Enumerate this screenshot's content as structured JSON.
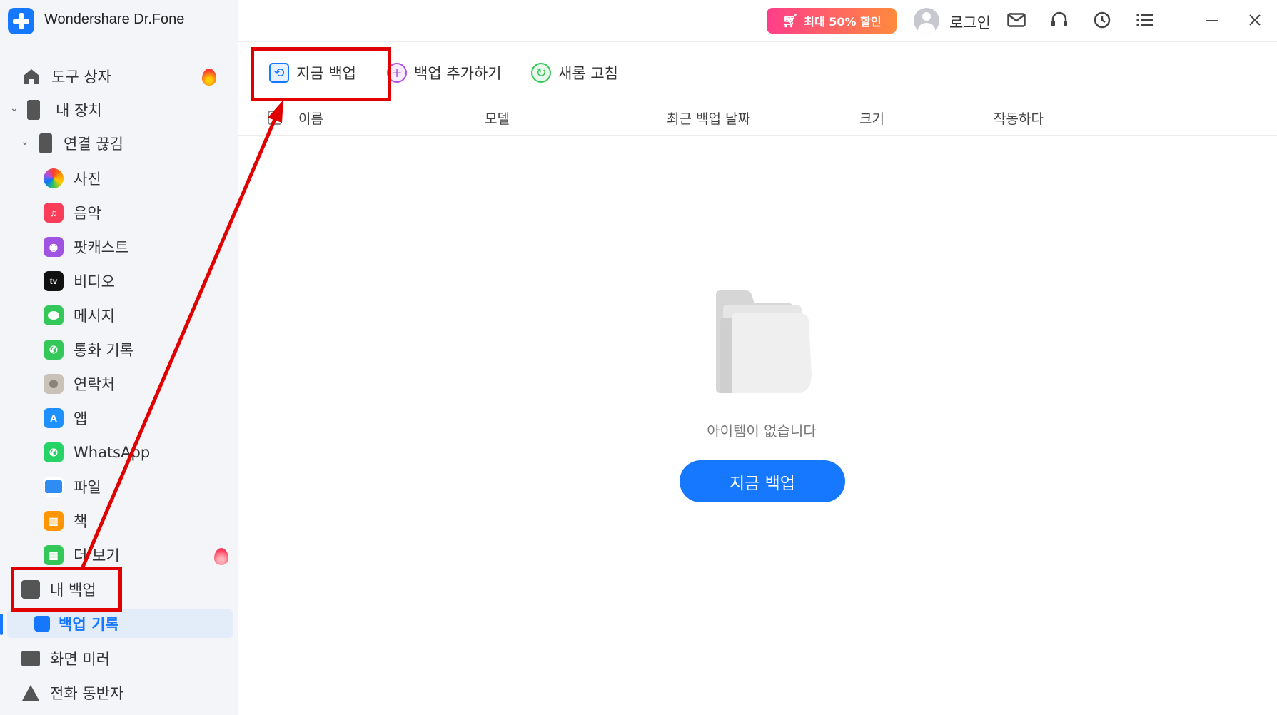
{
  "app": {
    "title": "Wondershare Dr.Fone",
    "logo_icon": "plus-logo-icon"
  },
  "topbar": {
    "promo_label": "최대 50% 할인",
    "login_label": "로그인",
    "icons": [
      "mail-icon",
      "headset-icon",
      "history-icon",
      "menu-icon",
      "minimize-icon",
      "close-icon"
    ]
  },
  "sidebar": {
    "toolbox": "도구 상자",
    "my_devices": "내 장치",
    "disconnected": "연결 끊김",
    "items": [
      {
        "label": "사진",
        "icon": "photos-icon",
        "color": "#ffffff"
      },
      {
        "label": "음악",
        "icon": "music-icon",
        "color": "#fa3e5a"
      },
      {
        "label": "팟캐스트",
        "icon": "podcast-icon",
        "color": "#a052e0"
      },
      {
        "label": "비디오",
        "icon": "appletv-icon",
        "color": "#111111"
      },
      {
        "label": "메시지",
        "icon": "messages-icon",
        "color": "#34c759"
      },
      {
        "label": "통화 기록",
        "icon": "phone-icon",
        "color": "#34c759"
      },
      {
        "label": "연락처",
        "icon": "contacts-icon",
        "color": "#b8b8b8"
      },
      {
        "label": "앱",
        "icon": "appstore-icon",
        "color": "#1e90ff"
      },
      {
        "label": "WhatsApp",
        "icon": "whatsapp-icon",
        "color": "#25d366"
      },
      {
        "label": "파일",
        "icon": "files-icon",
        "color": "#2f8cf2"
      },
      {
        "label": "책",
        "icon": "books-icon",
        "color": "#ff9500"
      },
      {
        "label": "더 보기",
        "icon": "more-icon",
        "color": "#34c759"
      }
    ],
    "my_backup": "내 백업",
    "backup_history": "백업 기록",
    "screen_mirror": "화면 미러",
    "phone_companion": "전화 동반자"
  },
  "toolbar": {
    "backup_now": "지금 백업",
    "add_backup": "백업 추가하기",
    "refresh": "새롬 고침"
  },
  "table": {
    "columns": [
      "이름",
      "모델",
      "최근 백업 날짜",
      "크기",
      "작동하다"
    ]
  },
  "empty_state": {
    "message": "아이템이 없습니다",
    "button_label": "지금 백업"
  },
  "colors": {
    "accent": "#1677ff",
    "annotation": "#e00000",
    "sidebar_bg": "#f3f5f9"
  }
}
